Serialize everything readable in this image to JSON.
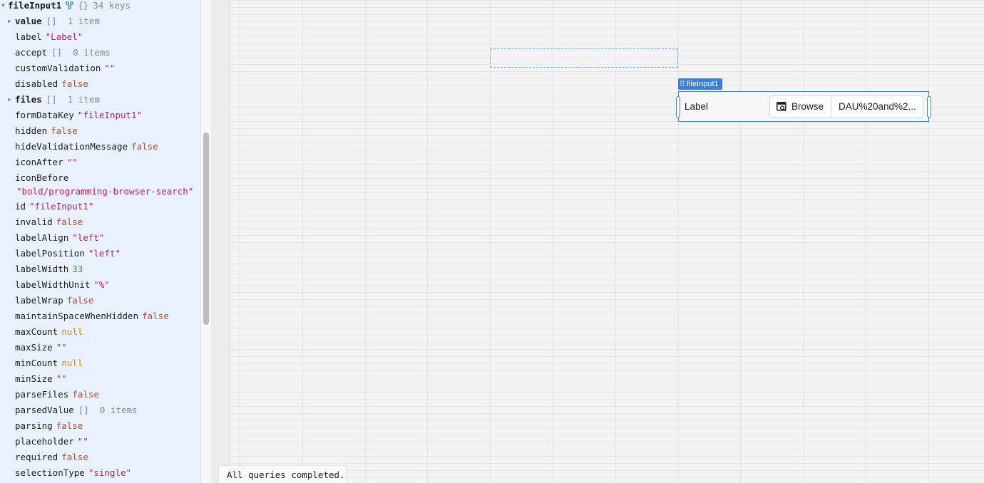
{
  "inspector": {
    "root": {
      "key": "fileInput1",
      "type_badge": "{}",
      "count": "34 keys",
      "icon": "component-tree-icon"
    },
    "rows": [
      {
        "key": "value",
        "meta": "[]  1 item",
        "expandable": true
      },
      {
        "key": "label",
        "value": "\"Label\"",
        "type": "str"
      },
      {
        "key": "accept",
        "meta": "[]  0 items"
      },
      {
        "key": "customValidation",
        "value": "\"\"",
        "type": "str"
      },
      {
        "key": "disabled",
        "value": "false",
        "type": "bool"
      },
      {
        "key": "files",
        "meta": "[]  1 item",
        "expandable": true
      },
      {
        "key": "formDataKey",
        "value": "\"fileInput1\"",
        "type": "str"
      },
      {
        "key": "hidden",
        "value": "false",
        "type": "bool"
      },
      {
        "key": "hideValidationMessage",
        "value": "false",
        "type": "bool"
      },
      {
        "key": "iconAfter",
        "value": "\"\"",
        "type": "str"
      },
      {
        "key": "iconBefore",
        "value": "\"bold/programming-browser-search\"",
        "type": "str",
        "wrap": true
      },
      {
        "key": "id",
        "value": "\"fileInput1\"",
        "type": "str"
      },
      {
        "key": "invalid",
        "value": "false",
        "type": "bool"
      },
      {
        "key": "labelAlign",
        "value": "\"left\"",
        "type": "str"
      },
      {
        "key": "labelPosition",
        "value": "\"left\"",
        "type": "str"
      },
      {
        "key": "labelWidth",
        "value": "33",
        "type": "num"
      },
      {
        "key": "labelWidthUnit",
        "value": "\"%\"",
        "type": "str"
      },
      {
        "key": "labelWrap",
        "value": "false",
        "type": "bool"
      },
      {
        "key": "maintainSpaceWhenHidden",
        "value": "false",
        "type": "bool"
      },
      {
        "key": "maxCount",
        "value": "null",
        "type": "nul"
      },
      {
        "key": "maxSize",
        "value": "\"\"",
        "type": "str"
      },
      {
        "key": "minCount",
        "value": "null",
        "type": "nul"
      },
      {
        "key": "minSize",
        "value": "\"\"",
        "type": "str"
      },
      {
        "key": "parseFiles",
        "value": "false",
        "type": "bool"
      },
      {
        "key": "parsedValue",
        "meta": "[]  0 items"
      },
      {
        "key": "parsing",
        "value": "false",
        "type": "bool"
      },
      {
        "key": "placeholder",
        "value": "\"\"",
        "type": "str"
      },
      {
        "key": "required",
        "value": "false",
        "type": "bool"
      },
      {
        "key": "selectionType",
        "value": "\"single\"",
        "type": "str"
      }
    ]
  },
  "canvas": {
    "component_tag": "fileInput1",
    "component": {
      "label": "Label",
      "browse_label": "Browse",
      "browse_icon": "browser-search-icon",
      "file_name": "DAU%20and%2..."
    }
  },
  "status": {
    "text": "All queries completed."
  },
  "colors": {
    "inspector_bg": "#e8f1fc",
    "selection_accent": "#3b7dd8",
    "string": "#b8206b",
    "boolean": "#c0462f",
    "number": "#3e8a3e",
    "null": "#d98e00"
  }
}
